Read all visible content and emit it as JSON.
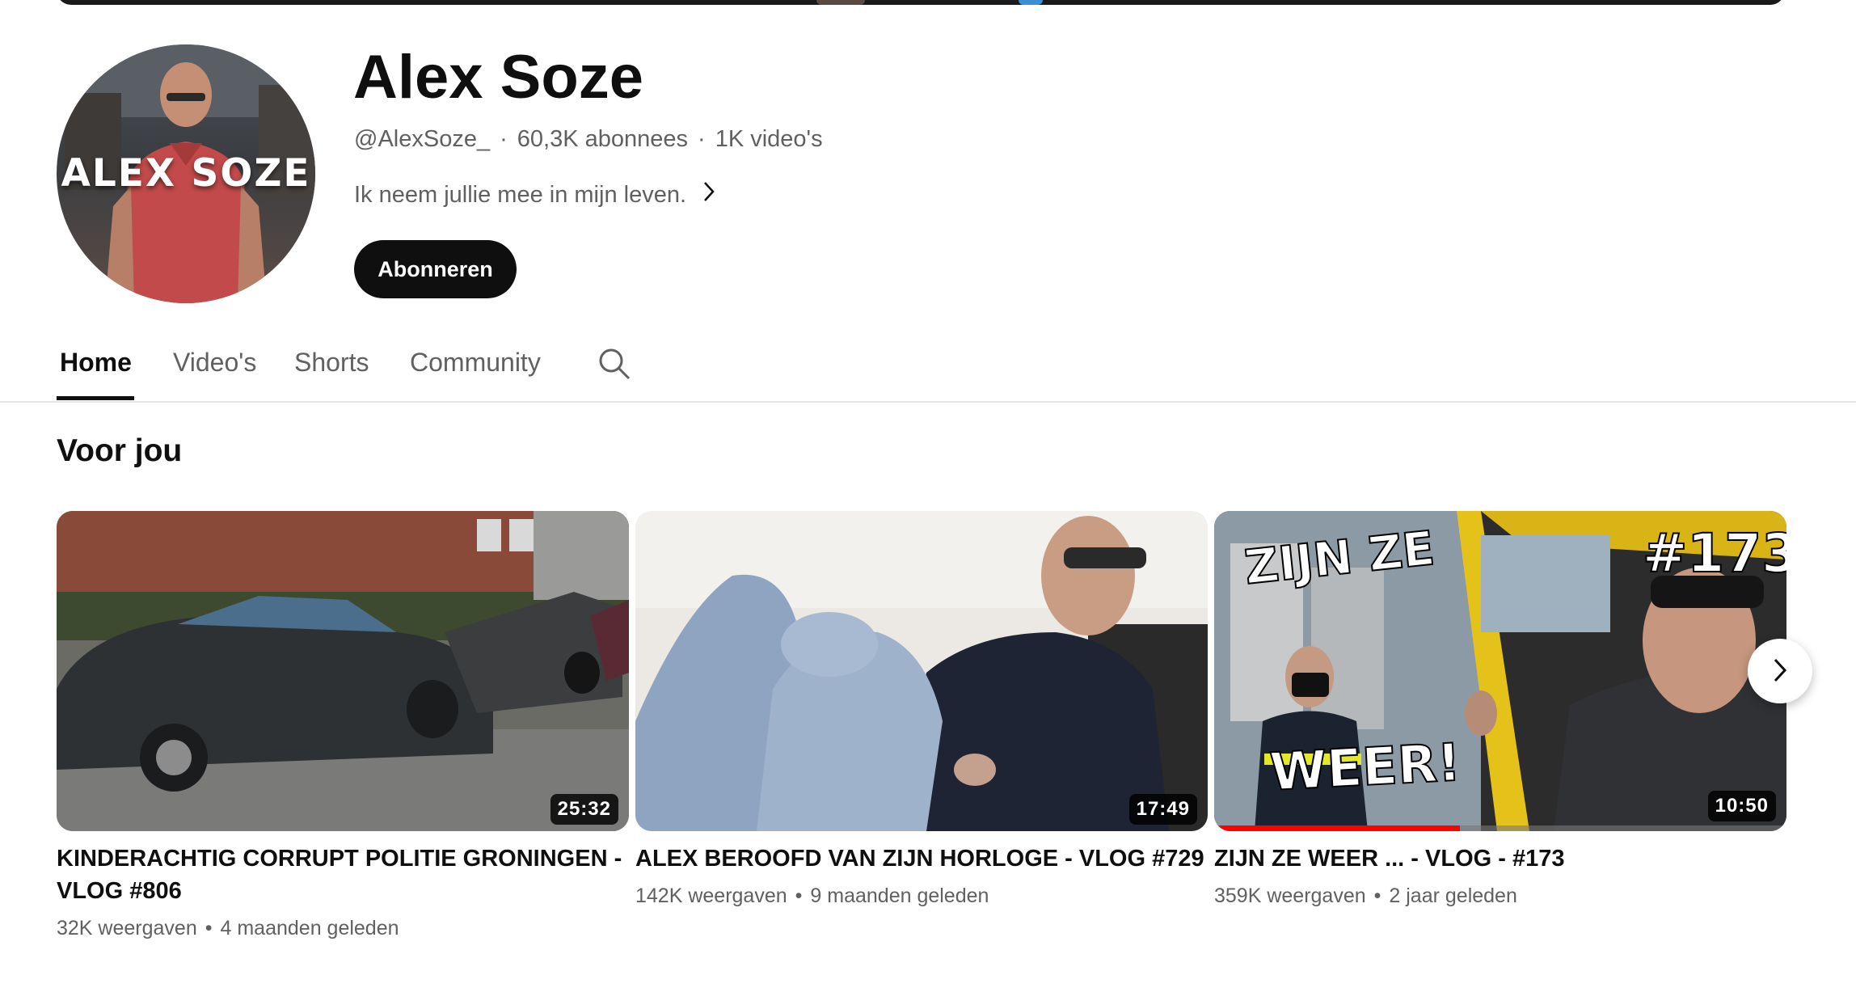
{
  "channel": {
    "name": "Alex Soze",
    "avatar_text": "ALEX SOZE",
    "handle": "@AlexSoze_",
    "subscribers": "60,3K abonnees",
    "video_count": "1K video's",
    "separator": "·",
    "description": "Ik neem jullie mee in mijn leven.",
    "subscribe_label": "Abonneren"
  },
  "tabs": [
    {
      "label": "Home",
      "active": true
    },
    {
      "label": "Video's",
      "active": false
    },
    {
      "label": "Shorts",
      "active": false
    },
    {
      "label": "Community",
      "active": false
    }
  ],
  "section": {
    "title": "Voor jou"
  },
  "videos": [
    {
      "title": "KINDERACHTIG CORRUPT POLITIE GRONINGEN - VLOG #806",
      "duration": "25:32",
      "views": "32K weergaven",
      "age": "4 maanden geleden",
      "dot": "•"
    },
    {
      "title": "ALEX BEROOFD VAN ZIJN HORLOGE - VLOG #729",
      "duration": "17:49",
      "views": "142K weergaven",
      "age": "9 maanden geleden",
      "dot": "•"
    },
    {
      "title": "ZIJN ZE WEER ... - VLOG - #173",
      "duration": "10:50",
      "views": "359K weergaven",
      "age": "2 jaar geleden",
      "dot": "•",
      "watch_progress": 0.43,
      "thumb_text": {
        "top_left": "ZIJN ZE",
        "bottom": "WEER!",
        "top_right": "#173"
      }
    }
  ],
  "icons": {
    "chevron_right": "chevron-right-icon",
    "search": "search-icon",
    "carousel_next": "carousel-next-icon"
  },
  "colors": {
    "subscribe_bg": "#0f0f0f",
    "progress": "#ff0000",
    "secondary_text": "#606060"
  }
}
